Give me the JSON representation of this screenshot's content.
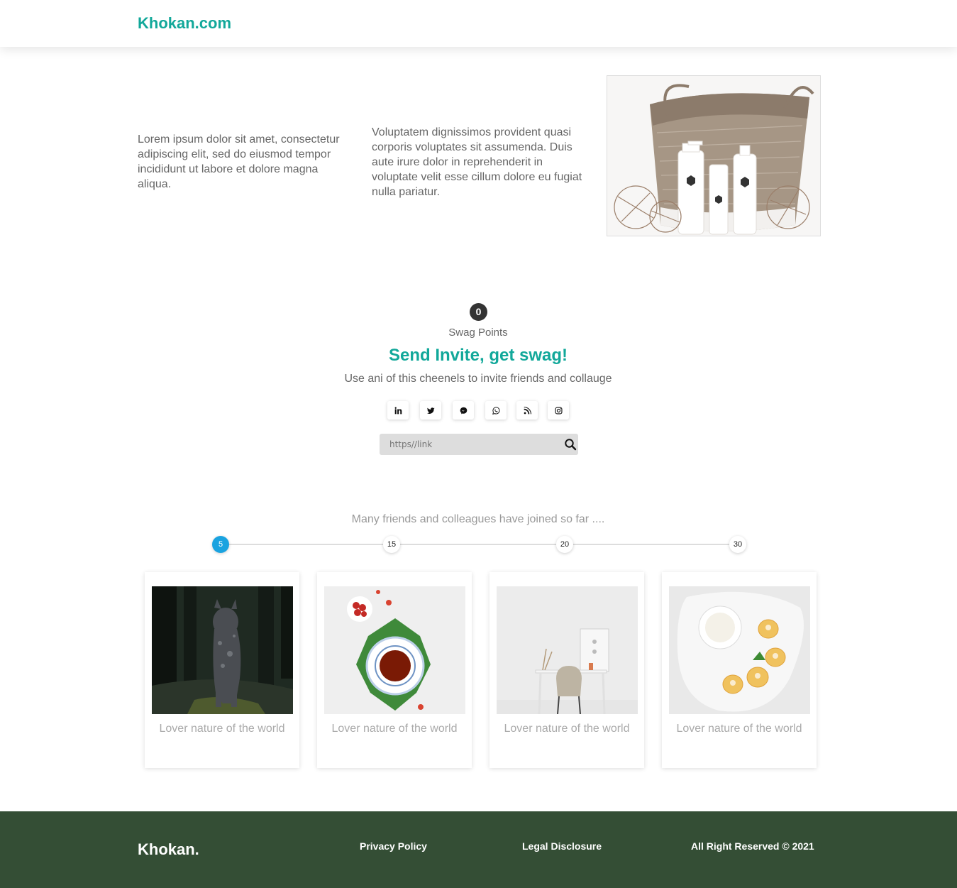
{
  "header": {
    "brand": "Khokan.com"
  },
  "hero": {
    "text_left": "Lorem ipsum dolor sit amet, consectetur adipiscing elit, sed do eiusmod tempor incididunt ut labore et dolore magna aliqua.",
    "text_right": "Voluptatem dignissimos provident quasi corporis voluptates sit assumenda. Duis aute irure dolor in reprehenderit in voluptate velit esse cillum dolore eu fugiat nulla pariatur."
  },
  "swag": {
    "points": "0",
    "points_label": "Swag Points",
    "title": "Send Invite, get swag!",
    "subtitle": "Use ani of this cheenels to invite friends and collauge",
    "socials": [
      {
        "icon": "linkedin-icon"
      },
      {
        "icon": "twitter-icon"
      },
      {
        "icon": "messenger-icon"
      },
      {
        "icon": "whatsapp-icon"
      },
      {
        "icon": "rss-icon"
      },
      {
        "icon": "instagram-icon"
      }
    ],
    "link_placeholder": "https//link"
  },
  "progress": {
    "text": "Many friends and colleagues have joined so far ....",
    "steps": [
      "5",
      "15",
      "20",
      "30"
    ],
    "active_step": "5"
  },
  "cards": [
    {
      "caption": "Lover nature of the world",
      "image": "dog in forest"
    },
    {
      "caption": "Lover nature of the world",
      "image": "tea cup on leaf with raspberries"
    },
    {
      "caption": "Lover nature of the world",
      "image": "white desk with chair"
    },
    {
      "caption": "Lover nature of the world",
      "image": "plate with cookies and milk"
    }
  ],
  "footer": {
    "brand": "Khokan.",
    "links": [
      "Privacy Policy",
      "Legal Disclosure"
    ],
    "copyright": "All Right Reserved © 2021"
  },
  "colors": {
    "accent": "#12a89a",
    "footer_bg": "#344e35",
    "active_step": "#1aa3e0"
  }
}
